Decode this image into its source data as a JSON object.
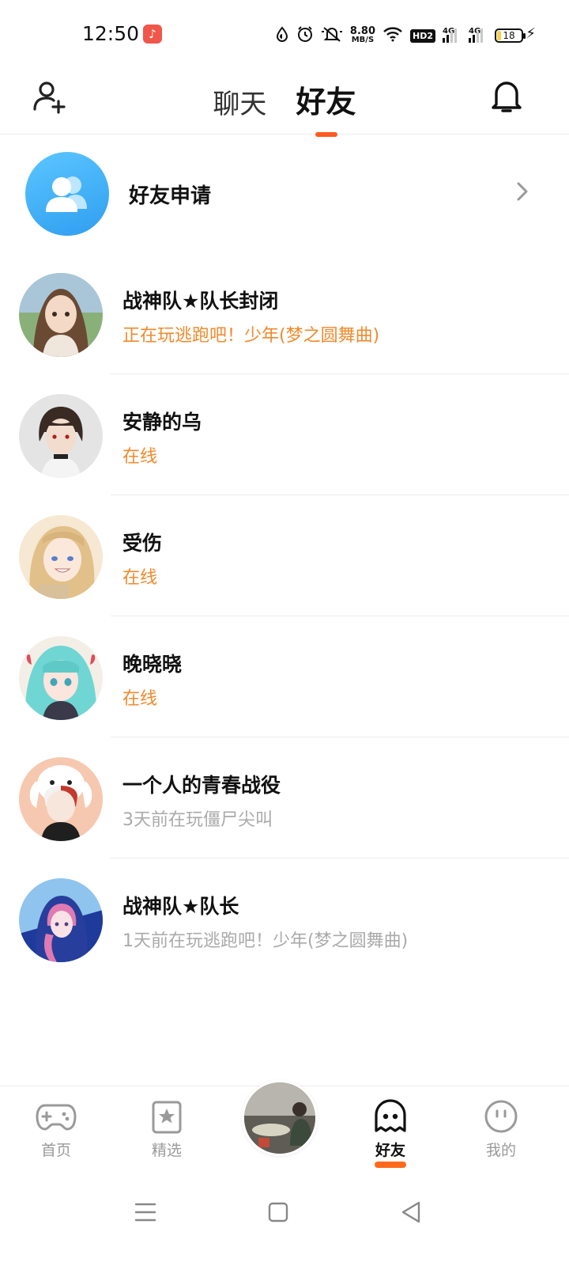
{
  "status_bar": {
    "time": "12:50",
    "net_speed_value": "8.80",
    "net_speed_unit": "MB/S",
    "hd_label": "HD2",
    "sim1_label": "4G",
    "sim2_label": "4G",
    "battery_level": "18",
    "app_icon": "music-app-icon"
  },
  "header": {
    "tabs": [
      {
        "label": "聊天",
        "active": false
      },
      {
        "label": "好友",
        "active": true
      }
    ]
  },
  "friend_request": {
    "label": "好友申请"
  },
  "friends": [
    {
      "name": "战神队★队长封闭",
      "status": "正在玩逃跑吧！少年(梦之圆舞曲)",
      "status_type": "online"
    },
    {
      "name": "安静的乌",
      "status": "在线",
      "status_type": "online"
    },
    {
      "name": "受伤",
      "status": "在线",
      "status_type": "online"
    },
    {
      "name": "晚晓晓",
      "status": "在线",
      "status_type": "online"
    },
    {
      "name": "一个人的青春战役",
      "status": "3天前在玩僵尸尖叫",
      "status_type": "offline"
    },
    {
      "name": "战神队★队长",
      "status": "1天前在玩逃跑吧！少年(梦之圆舞曲)",
      "status_type": "offline"
    }
  ],
  "bottom_nav": {
    "items": [
      {
        "label": "首页",
        "icon": "gamepad-icon",
        "active": false
      },
      {
        "label": "精选",
        "icon": "star-bookmark-icon",
        "active": false
      },
      {
        "label": "好友",
        "icon": "ghost-icon",
        "active": true
      },
      {
        "label": "我的",
        "icon": "smiley-icon",
        "active": false
      }
    ]
  },
  "colors": {
    "accent": "#ff5a1f",
    "online_status": "#f08a2c",
    "offline_status": "#aaaaaa",
    "request_avatar": "#39a9f5"
  }
}
